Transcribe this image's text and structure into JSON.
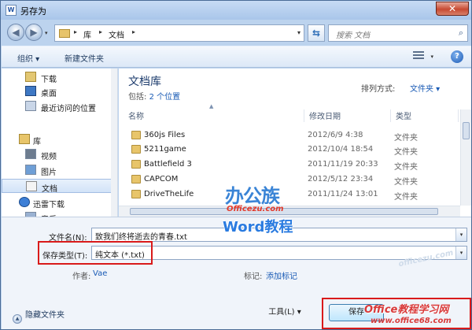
{
  "window": {
    "title": "另存为",
    "app_icon": "W",
    "close_glyph": "✕"
  },
  "nav": {
    "back": "◀",
    "forward": "▶",
    "drop": "▾"
  },
  "address": {
    "crumbs": [
      "库",
      "文档"
    ],
    "arrow": "▸",
    "refresh_glyph": "⇆"
  },
  "search": {
    "placeholder": "搜索 文档",
    "icon": "search-icon"
  },
  "toolbar": {
    "organize": "组织 ▾",
    "new_folder": "新建文件夹",
    "help": "?"
  },
  "sidebar": {
    "items": [
      {
        "label": "下载",
        "icon": "downloads-icon"
      },
      {
        "label": "桌面",
        "icon": "desktop-icon"
      },
      {
        "label": "最近访问的位置",
        "icon": "recent-places-icon"
      },
      {
        "label": "库",
        "icon": "library-icon"
      },
      {
        "label": "视频",
        "icon": "video-icon"
      },
      {
        "label": "图片",
        "icon": "pictures-icon"
      },
      {
        "label": "文档",
        "icon": "documents-icon"
      },
      {
        "label": "迅雷下载",
        "icon": "xunlei-icon"
      },
      {
        "label": "音乐",
        "icon": "music-icon"
      }
    ]
  },
  "library": {
    "title": "文档库",
    "includes_prefix": "包括:",
    "includes_value": "2 个位置",
    "arrange_label": "排列方式:",
    "arrange_value": "文件夹 ▾"
  },
  "columns": [
    "名称",
    "修改日期",
    "类型"
  ],
  "files": [
    {
      "name": "360js Files",
      "date": "2012/6/9 4:38",
      "type": "文件夹"
    },
    {
      "name": "5211game",
      "date": "2012/10/4 18:54",
      "type": "文件夹"
    },
    {
      "name": "Battlefield 3",
      "date": "2011/11/19 20:33",
      "type": "文件夹"
    },
    {
      "name": "CAPCOM",
      "date": "2012/5/12 23:34",
      "type": "文件夹"
    },
    {
      "name": "DriveTheLife",
      "date": "2011/11/24 13:01",
      "type": "文件夹"
    }
  ],
  "form": {
    "filename_label": "文件名(N):",
    "filename_value": "致我们终将逝去的青春.txt",
    "filetype_label": "保存类型(T):",
    "filetype_value": "纯文本 (*.txt)",
    "author_label": "作者:",
    "author_value": "Vae",
    "tags_label": "标记:",
    "tags_value": "添加标记",
    "hide_folders": "隐藏文件夹",
    "tools_button": "工具(L)",
    "save_button": "保存"
  },
  "watermarks": {
    "bgg": "办公族",
    "site": "Officezu.com",
    "word": "Word教程",
    "right1": "Office教程学习网",
    "right2": "www.office68.com",
    "faint": "officezu.com"
  },
  "colors": {
    "highlight_box": "#d91a1a",
    "link": "#1a5bb5",
    "title_bar": "#bcd3ee"
  }
}
